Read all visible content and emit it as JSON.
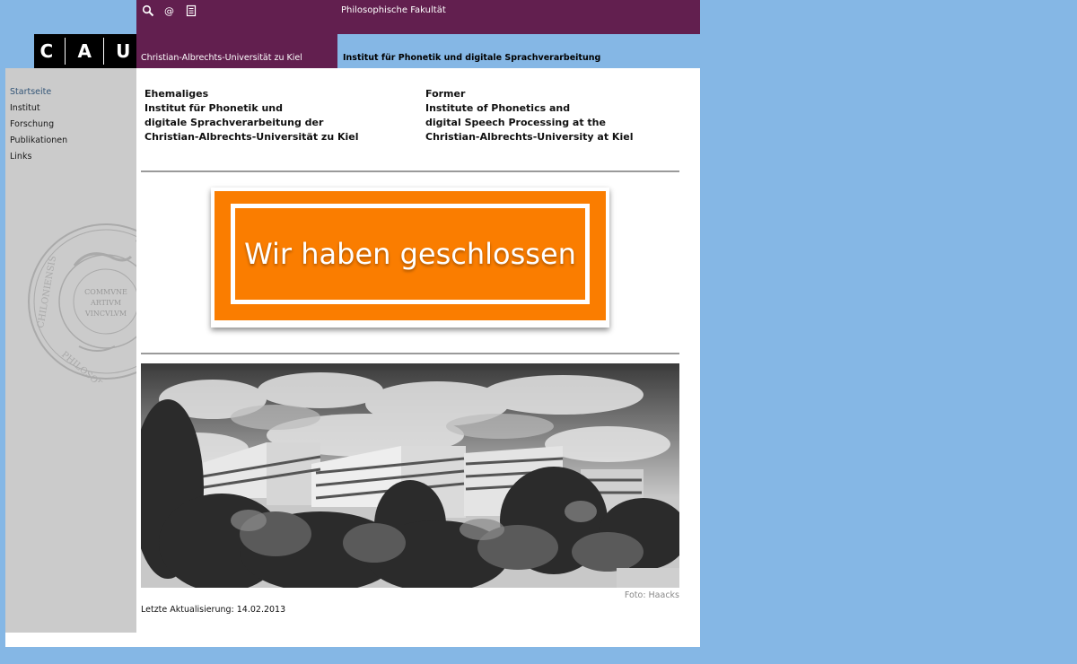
{
  "header": {
    "faculty": "Philosophische Fakultät",
    "university": "Christian-Albrechts-Universität zu Kiel",
    "institute": "Institut für Phonetik und digitale Sprachverarbeitung",
    "logo_letters": [
      "C",
      "A",
      "U"
    ],
    "icons": [
      "search-icon",
      "email-icon",
      "document-icon"
    ]
  },
  "sidebar": {
    "items": [
      {
        "label": "Startseite"
      },
      {
        "label": "Institut"
      },
      {
        "label": "Forschung"
      },
      {
        "label": "Publikationen"
      },
      {
        "label": "Links"
      }
    ],
    "seal_text": {
      "ring": "CHILONIENSIS SIGILLUM PHILOSOPHICI",
      "center": [
        "COMMVNE",
        "ARTIVM",
        "VINCVLVM"
      ]
    }
  },
  "main": {
    "german": [
      "Ehemaliges",
      "Institut für Phonetik und",
      "digitale Sprachverarbeitung der",
      "Christian-Albrechts-Universität zu Kiel"
    ],
    "english": [
      "Former",
      "Institute of Phonetics and",
      "digital Speech Processing at the",
      "Christian-Albrechts-University at Kiel"
    ],
    "banner_text": "Wir haben geschlossen",
    "photo_credit": "Foto: Haacks",
    "last_updated": "Letzte Aktualisierung: 14.02.2013"
  },
  "colors": {
    "background": "#85b7e5",
    "brand_purple": "#621f4f",
    "banner_orange": "#fa7d00",
    "sidebar_gray": "#cbcbcb"
  }
}
